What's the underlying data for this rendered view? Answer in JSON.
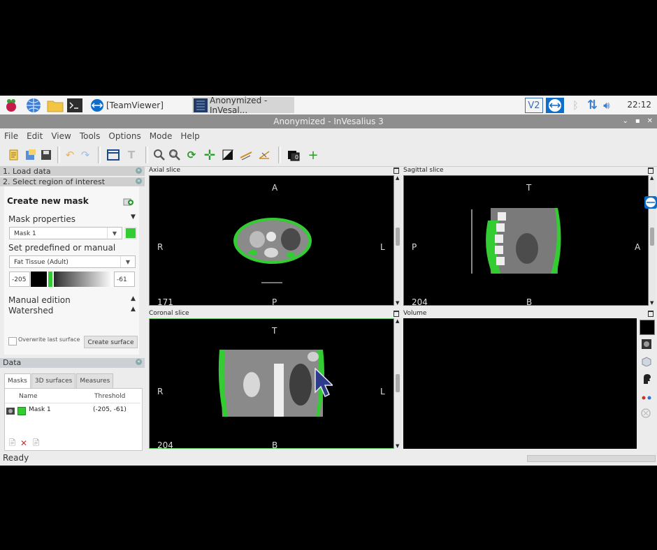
{
  "taskbar": {
    "tasks": [
      {
        "label": "[TeamViewer]"
      },
      {
        "label": "Anonymized - InVesal..."
      }
    ],
    "clock": "22:12",
    "tray_vnc": "V2"
  },
  "window": {
    "title": "Anonymized - InVesalius 3",
    "btn_min": "⌄",
    "btn_max": "▪",
    "btn_close": "✕"
  },
  "menu": [
    "File",
    "Edit",
    "View",
    "Tools",
    "Options",
    "Mode",
    "Help"
  ],
  "panel": {
    "step1": "1. Load data",
    "step2": "2. Select region of interest",
    "create_mask": "Create new mask",
    "mask_properties": "Mask properties",
    "mask_select": "Mask 1",
    "mask_color": "#33cc33",
    "set_predefined": "Set predefined or manual",
    "preset_select": "Fat Tissue (Adult)",
    "threshold_min": "-205",
    "threshold_max": "-61",
    "manual_edition": "Manual edition",
    "watershed": "Watershed",
    "overwrite_label": "Overwrite last surface",
    "create_surface": "Create surface",
    "expand_arrow": "▼",
    "collapse_arrow": "▲"
  },
  "data": {
    "title": "Data",
    "tabs": [
      "Masks",
      "3D surfaces",
      "Measures"
    ],
    "col_name": "Name",
    "col_threshold": "Threshold",
    "rows": [
      {
        "name": "Mask 1",
        "threshold": "(-205, -61)",
        "color": "#33cc33"
      }
    ]
  },
  "viewers": {
    "axial": {
      "title": "Axial slice",
      "top": "A",
      "bottom": "P",
      "left": "R",
      "right": "L",
      "slice": "171",
      "border": "#e06a6a"
    },
    "sagittal": {
      "title": "Sagittal slice",
      "top": "T",
      "bottom": "B",
      "left": "P",
      "right": "A",
      "slice": "204",
      "border": "#5a5ae0"
    },
    "coronal": {
      "title": "Coronal slice",
      "top": "T",
      "bottom": "B",
      "left": "R",
      "right": "L",
      "slice": "204",
      "border": "#5ac85a"
    },
    "volume": {
      "title": "Volume"
    }
  },
  "status": "Ready",
  "colors": {
    "mask_green": "#33cc33",
    "titlebar": "#8e8e8e"
  }
}
